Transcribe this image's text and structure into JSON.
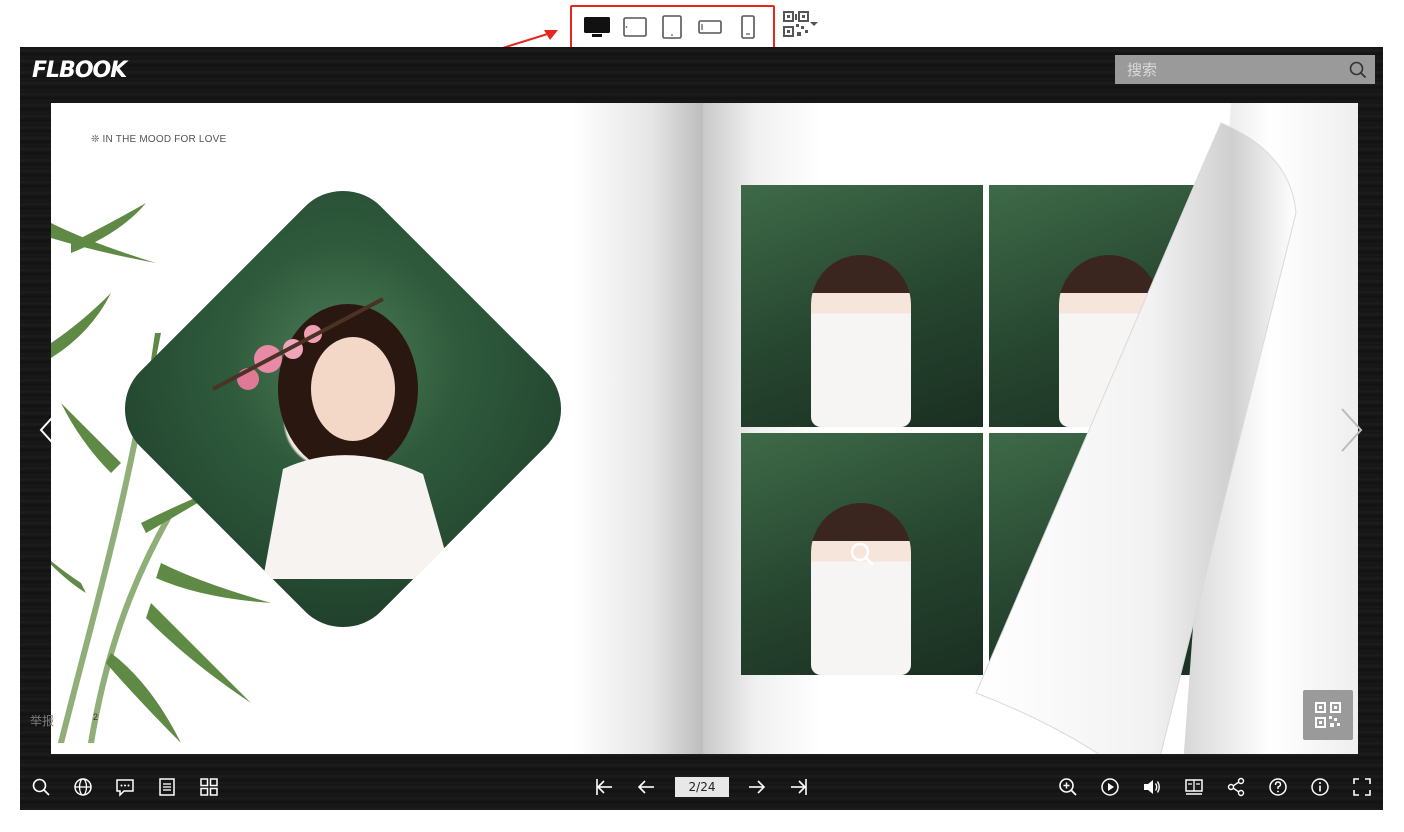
{
  "device_bar": {
    "items": [
      "desktop-icon",
      "tablet-landscape-icon",
      "tablet-portrait-icon",
      "phone-landscape-icon",
      "phone-portrait-icon"
    ],
    "active": "desktop-icon",
    "highlight_color": "#e5261f"
  },
  "qr_dropdown": {
    "icon": "qr-code-icon"
  },
  "viewer": {
    "logo": "FLBOOK",
    "search": {
      "placeholder": "搜索"
    },
    "left_page": {
      "heading": "❊ IN THE MOOD FOR LOVE",
      "page_number": "2"
    },
    "report_link": "举报",
    "page_indicator": "2/24"
  },
  "toolbar": {
    "left": [
      "search-icon",
      "globe-icon",
      "comment-icon",
      "list-icon",
      "thumbnails-icon"
    ],
    "center": [
      "first-page-icon",
      "prev-page-icon",
      "next-page-icon",
      "last-page-icon"
    ],
    "right": [
      "zoom-in-icon",
      "autoplay-icon",
      "sound-icon",
      "bookmark-icon",
      "share-icon",
      "help-icon",
      "info-icon",
      "fullscreen-icon"
    ]
  },
  "colors": {
    "viewer_bg": "#161616",
    "search_bg": "#9a9a9a",
    "accent_red": "#e5261f"
  }
}
